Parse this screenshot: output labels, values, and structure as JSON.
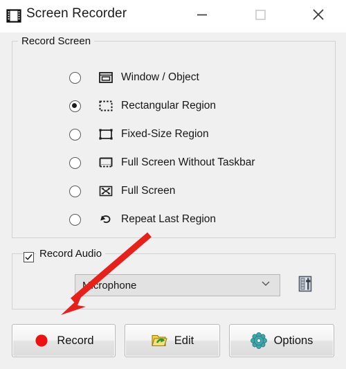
{
  "window": {
    "title": "Screen Recorder",
    "app_icon": "film-strip-icon",
    "controls": {
      "minimize": "minimize-icon",
      "maximize": "maximize-icon",
      "close": "close-icon"
    }
  },
  "record_screen_group": {
    "legend": "Record Screen",
    "options": [
      {
        "label": "Window / Object",
        "icon": "window-object-icon",
        "selected": false
      },
      {
        "label": "Rectangular Region",
        "icon": "rectangular-region-icon",
        "selected": true
      },
      {
        "label": "Fixed-Size Region",
        "icon": "fixed-size-region-icon",
        "selected": false
      },
      {
        "label": "Full Screen Without Taskbar",
        "icon": "full-screen-no-taskbar-icon",
        "selected": false
      },
      {
        "label": "Full Screen",
        "icon": "full-screen-icon",
        "selected": false
      },
      {
        "label": "Repeat Last Region",
        "icon": "repeat-last-region-icon",
        "selected": false
      }
    ]
  },
  "record_audio_group": {
    "legend": "Record Audio",
    "checked": true,
    "device": {
      "value": "Microphone",
      "placeholder": "Microphone",
      "arrow_icon": "chevron-down-icon"
    },
    "mixer_button_icon": "audio-mixer-icon"
  },
  "buttons": {
    "record": {
      "label": "Record",
      "icon": "red-record-dot-icon",
      "icon_color": "#ee1111"
    },
    "edit": {
      "label": "Edit",
      "icon": "folder-open-icon",
      "icon_color": "#f2c012"
    },
    "options": {
      "label": "Options",
      "icon": "gear-icon",
      "icon_color": "#3aa9a9"
    }
  },
  "annotation": {
    "arrow_color": "#e8201a",
    "points_at": "Record"
  }
}
